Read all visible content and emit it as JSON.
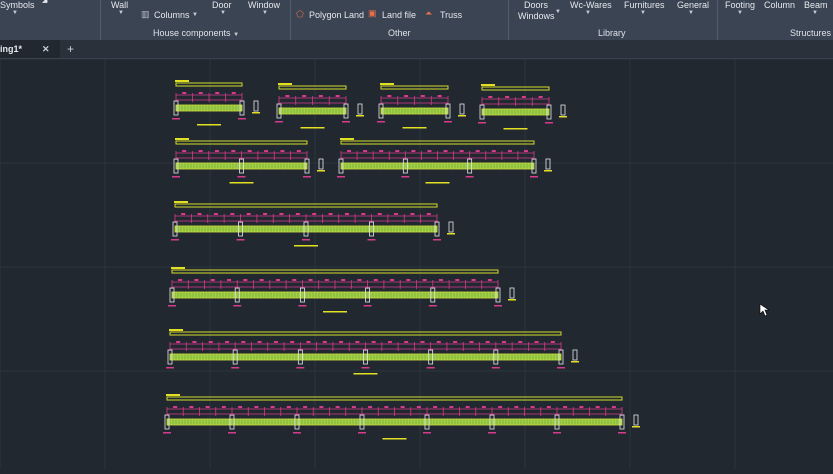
{
  "ribbon": {
    "symbols": "Symbols",
    "wall": "Wall",
    "columns": "Columns",
    "door": "Door",
    "window": "Window",
    "house_components": "House components",
    "polygon_land": "Polygon Land",
    "land_file": "Land file",
    "truss": "Truss",
    "other": "Other",
    "doors_windows_1": "Doors",
    "doors_windows_2": "Windows",
    "wc_wares": "Wc-Wares",
    "furnitures": "Furnitures",
    "general": "General",
    "library": "Library",
    "footing": "Footing",
    "column": "Column",
    "beam": "Beam",
    "structures": "Structures"
  },
  "tabs": {
    "active_label": "ing1*",
    "close": "✕",
    "add": "+"
  },
  "colors": {
    "ribbon_bg": "#3b4453",
    "canvas_bg": "#212830",
    "beam_fill": "#9fcf47",
    "beam_outline": "#d8e83a",
    "title_bar": "#d4dc2a",
    "dimension": "#d83a8c",
    "label": "#e3e024"
  },
  "drawing": {
    "beams": [
      {
        "spans": 1
      },
      {
        "spans": 1
      },
      {
        "spans": 1
      },
      {
        "spans": 1
      },
      {
        "spans": 2
      },
      {
        "spans": 3
      },
      {
        "spans": 4
      },
      {
        "spans": 5
      },
      {
        "spans": 6
      },
      {
        "spans": 7
      }
    ]
  }
}
